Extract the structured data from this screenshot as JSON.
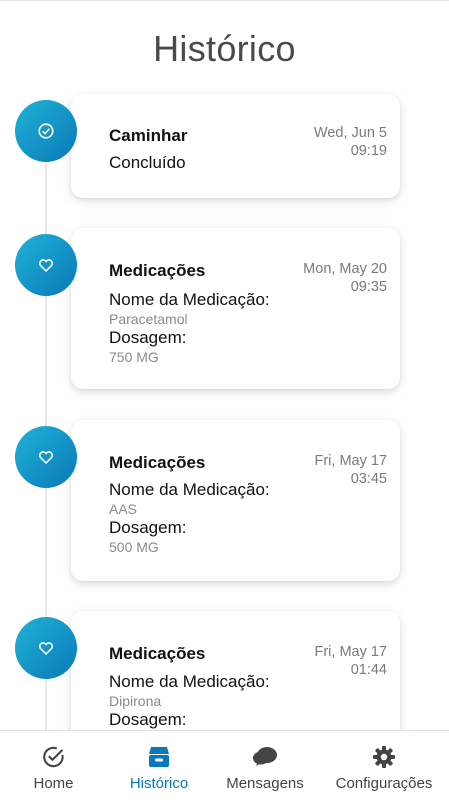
{
  "page": {
    "title": "Histórico"
  },
  "entries": [
    {
      "icon": "check-circle-icon",
      "title": "Caminhar",
      "day": "Wed, Jun 5",
      "time": "09:19",
      "status": "Concluído"
    },
    {
      "icon": "heart-icon",
      "title": "Medicações",
      "day": "Mon, May 20",
      "time": "09:35",
      "med_label": "Nome da Medicação:",
      "med_value": "Paracetamol",
      "dose_label": "Dosagem:",
      "dose_value": "750 MG"
    },
    {
      "icon": "heart-icon",
      "title": "Medicações",
      "day": "Fri, May 17",
      "time": "03:45",
      "med_label": "Nome da Medicação:",
      "med_value": "AAS",
      "dose_label": "Dosagem:",
      "dose_value": "500 MG"
    },
    {
      "icon": "heart-icon",
      "title": "Medicações",
      "day": "Fri, May 17",
      "time": "01:44",
      "med_label": "Nome da Medicação:",
      "med_value": "Dipirona",
      "dose_label": "Dosagem:",
      "dose_value": ""
    }
  ],
  "nav": {
    "items": [
      {
        "label": "Home",
        "icon": "check-circle-icon",
        "active": false
      },
      {
        "label": "Histórico",
        "icon": "archive-icon",
        "active": true
      },
      {
        "label": "Mensagens",
        "icon": "chat-bubbles-icon",
        "active": false
      },
      {
        "label": "Configurações",
        "icon": "gear-icon",
        "active": false
      }
    ]
  },
  "colors": {
    "accent": "#0a78b8",
    "accent_light": "#1fb3d6",
    "text_muted": "#8a8a8a"
  }
}
